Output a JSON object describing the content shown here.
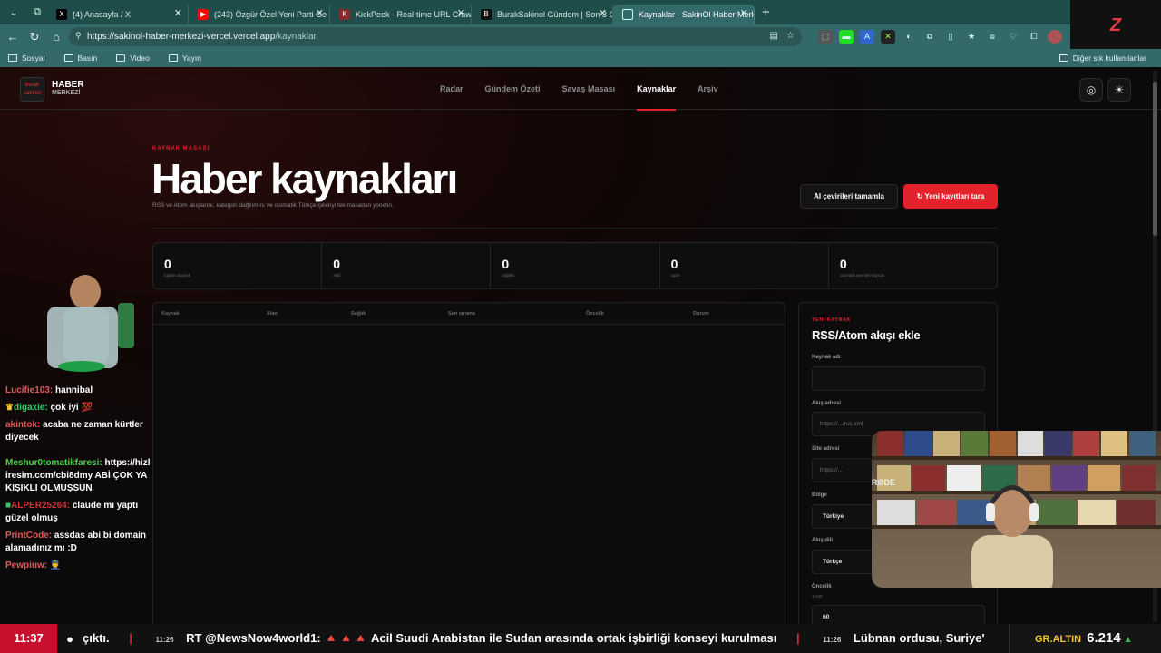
{
  "browser": {
    "tabs": [
      {
        "label": "(4) Anasayfa / X",
        "favicon": "X",
        "color": "#000000"
      },
      {
        "label": "(243) Özgür Özel Yeni Parti Ge",
        "favicon": "▶",
        "color": "#ff0000"
      },
      {
        "label": "KickPeek - Real-time URL Crawler",
        "favicon": "K",
        "color": "#8a2b2b"
      },
      {
        "label": "BurakSakinol Gündem | Son 3 Gün",
        "favicon": "B",
        "color": "#111111"
      },
      {
        "label": "Kaynaklar - SakinOl Haber Merkezi",
        "favicon": "◎",
        "color": "#3d7c7b"
      }
    ],
    "url_host": "https://sakinol-haber-merkezi-vercel.vercel.app",
    "url_path": "/kaynaklar",
    "bookmarks": [
      "Sosyal",
      "Basın",
      "Video",
      "Yayın"
    ],
    "bookmarks_right": "Diğer sık kullanılanlar"
  },
  "site": {
    "logo_title": "HABER",
    "logo_sub": "MERKEZİ",
    "logo_mark": "burak sakinol",
    "nav": [
      "Radar",
      "Gündem Özeti",
      "Savaş Masası",
      "Kaynaklar",
      "Arşiv"
    ],
    "active_nav": "Kaynaklar"
  },
  "hero": {
    "eyebrow": "KAYNAK MASASI",
    "title": "Haber kaynakları",
    "lede": "RSS ve Atom akışlarını, kategori dağılımını ve otomatik Türkçe çeviriyi tek masadan yönetin.",
    "btn_translate": "AI çevirileri tamamla",
    "btn_scan": "↻ Yeni kayıtları tara"
  },
  "stats": [
    {
      "value": "0",
      "label": "toplam kaynak"
    },
    {
      "value": "0",
      "label": "aktif"
    },
    {
      "value": "0",
      "label": "sağlıklı"
    },
    {
      "value": "0",
      "label": "uyarı"
    },
    {
      "value": "0",
      "label": "otomatik çevrilen kaynak"
    }
  ],
  "table": {
    "columns": [
      "Kaynak",
      "Alan",
      "Sağlık",
      "Son tarama",
      "Öncelik",
      "Durum"
    ]
  },
  "form": {
    "eyebrow": "YENİ KAYNAK",
    "title": "RSS/Atom akışı ekle",
    "fields": {
      "name_label": "Kaynak adı",
      "name_value": "",
      "feed_label": "Akış adresi",
      "feed_placeholder": "https://.../rss.xml",
      "site_label": "Site adresi",
      "site_placeholder": "https://...",
      "region_label": "Bölge",
      "region_value": "Türkiye",
      "lang_label": "Akış dili",
      "lang_value": "Türkçe",
      "priority_label": "Öncelik",
      "priority_hint": "1-100",
      "priority_value": "60"
    }
  },
  "chat": [
    {
      "user": "Lucifie103:",
      "user_color": "#e05a5a",
      "text": "hannibal"
    },
    {
      "user": "digaxie:",
      "user_color": "#33cc66",
      "text": "çok iyi 💯"
    },
    {
      "user": "akintok:",
      "user_color": "#e05a5a",
      "text": "acaba ne zaman kürtler diyecek"
    },
    {
      "user": "Meshur0tomatikfaresi:",
      "user_color": "#4ccf4c",
      "text": "https://hizliresim.com/cbi8dmy ABİ ÇOK YAKIŞIKLI OLMUŞSUN"
    },
    {
      "user": "ALPER25264:",
      "user_color": "#cc3333",
      "text": "claude mı yaptı güzel olmuş"
    },
    {
      "user": "PrintCode:",
      "user_color": "#e05a5a",
      "text": "assdas abi bi domain alamadınız mı :D"
    },
    {
      "user": "Pewpiuw:",
      "user_color": "#e05a5a",
      "text": "👮"
    }
  ],
  "ticker": {
    "time": "11:37",
    "item_prefix": "çıktı.",
    "item1_time": "11:26",
    "item1_text": "RT @NewsNow4world1: 🔺🔺🔺 Acil Suudi Arabistan ile Sudan arasında ortak işbirliği konseyi kurulması",
    "item2_time": "11:26",
    "item2_text": "Lübnan ordusu, Suriye'",
    "price_label": "GR.ALTIN",
    "price_value": "6.214",
    "price_arrow": "▲"
  },
  "overlay": {
    "brand_letter": "Z",
    "webcam_text": "RØDE"
  }
}
